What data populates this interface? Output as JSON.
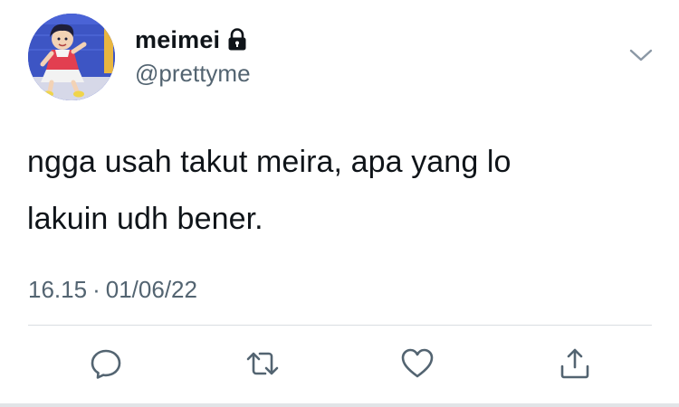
{
  "profile": {
    "display_name": "meimei",
    "handle": "@prettyme",
    "protected_icon": "lock-icon",
    "avatar_icon": "cartoon-avatar"
  },
  "tweet": {
    "text_lines": [
      "ngga usah takut meira, apa yang lo",
      "lakuin udh bener."
    ],
    "time": "16.15",
    "separator": "·",
    "date": "01/06/22"
  },
  "actions": {
    "reply_icon": "reply-icon",
    "retweet_icon": "retweet-icon",
    "like_icon": "heart-icon",
    "share_icon": "share-icon",
    "more_icon": "chevron-down-icon"
  },
  "colors": {
    "text_primary": "#0f1419",
    "text_secondary": "#536471",
    "icon_gray": "#536471",
    "divider": "#d9dde1",
    "avatar_bg": "#3f56c9"
  }
}
